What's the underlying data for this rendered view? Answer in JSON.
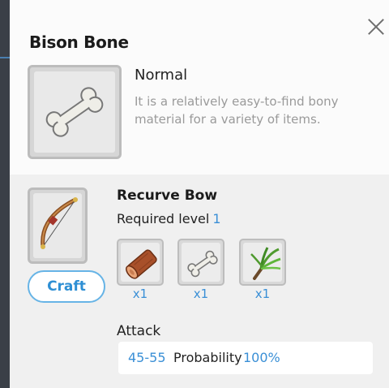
{
  "item": {
    "name": "Bison Bone",
    "rarity": "Normal",
    "description": "It is a relatively easy-to-find bony material for a variety of items.",
    "icon": "bone-icon"
  },
  "recipe": {
    "name": "Recurve Bow",
    "required_label": "Required level",
    "required_level": "1",
    "icon": "bow-icon",
    "craft_label": "Craft",
    "materials": [
      {
        "icon": "log-icon",
        "qty": "x1"
      },
      {
        "icon": "bone-icon",
        "qty": "x1"
      },
      {
        "icon": "herb-icon",
        "qty": "x1"
      }
    ],
    "stat_title": "Attack",
    "stat_range": "45-55",
    "probability_label": "Probability",
    "probability_value": "100%"
  },
  "colors": {
    "accent": "#3a8fd6",
    "craft_border": "#67b4e6",
    "description_text": "#9a9a9a"
  }
}
